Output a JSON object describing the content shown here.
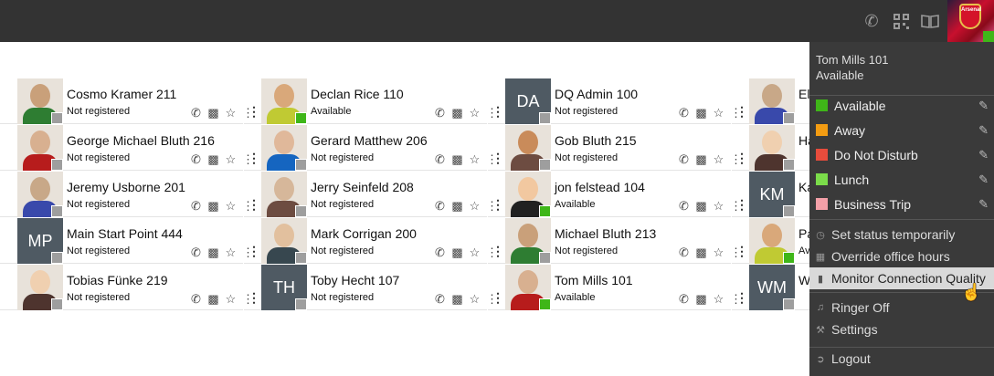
{
  "me": {
    "name_line": "Tom Mills  101",
    "status_line": "Available"
  },
  "status_options": [
    {
      "label": "Available",
      "color": "#3fb618"
    },
    {
      "label": "Away",
      "color": "#f39c12"
    },
    {
      "label": "Do Not Disturb",
      "color": "#e74c3c"
    },
    {
      "label": "Lunch",
      "color": "#7bdc4a"
    },
    {
      "label": "Business Trip",
      "color": "#f4a0a8"
    }
  ],
  "menu_items": [
    {
      "label": "Set status temporarily",
      "icon": "clock-icon"
    },
    {
      "label": "Override office hours",
      "icon": "calendar-icon"
    },
    {
      "label": "Monitor Connection Quality",
      "icon": "signal-icon"
    },
    {
      "label": "Ringer Off",
      "icon": "bell-off-icon"
    },
    {
      "label": "Settings",
      "icon": "wrench-icon"
    },
    {
      "label": "Logout",
      "icon": "logout-icon"
    }
  ],
  "contacts": [
    [
      {
        "name": "Cosmo Kramer 211",
        "status": "Not registered"
      },
      {
        "name": "George Michael Bluth 216",
        "status": "Not registered"
      },
      {
        "name": "Jeremy Usborne 201",
        "status": "Not registered"
      },
      {
        "name": "Main Start Point 444",
        "status": "Not registered",
        "initials": "MP"
      },
      {
        "name": "Tobias Fünke 219",
        "status": "Not registered"
      }
    ],
    [
      {
        "name": "Declan Rice 110",
        "status": "Available"
      },
      {
        "name": "Gerard Matthew 206",
        "status": "Not registered"
      },
      {
        "name": "Jerry Seinfeld 208",
        "status": "Not registered"
      },
      {
        "name": "Mark Corrigan 200",
        "status": "Not registered"
      },
      {
        "name": "Toby Hecht 107",
        "status": "Not registered",
        "initials": "TH"
      }
    ],
    [
      {
        "name": "DQ Admin 100",
        "status": "Not registered",
        "initials": "DA"
      },
      {
        "name": "Gob Bluth 215",
        "status": "Not registered"
      },
      {
        "name": "jon felstead 104",
        "status": "Available"
      },
      {
        "name": "Michael Bluth 213",
        "status": "Not registered"
      },
      {
        "name": "Tom Mills 101",
        "status": "Available"
      }
    ],
    [
      {
        "name": "El",
        "status": ""
      },
      {
        "name": "Ha",
        "status": ""
      },
      {
        "name": "Ka",
        "status": "",
        "initials": "KM"
      },
      {
        "name": "Pa",
        "status": "Av"
      },
      {
        "name": "W",
        "status": "",
        "initials": "WM"
      }
    ]
  ]
}
